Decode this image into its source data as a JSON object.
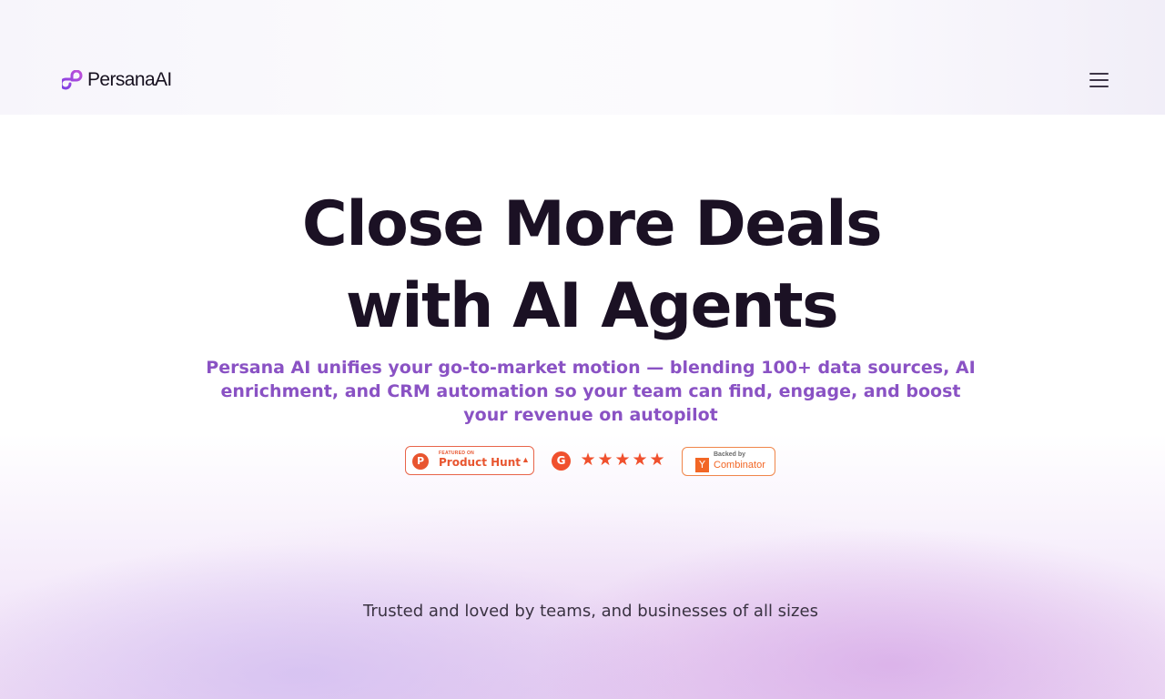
{
  "header": {
    "logo_text": "PersanaAI",
    "logo_icon": "persana-loop-icon",
    "menu_icon": "hamburger-menu-icon"
  },
  "hero": {
    "headline_line1": "Close More Deals",
    "headline_line2": "with AI Agents",
    "subtext": "Persana AI unifies your go-to-market motion — blending 100+ data sources, AI enrichment, and CRM automation so your team can find, engage, and boost your revenue on autopilot"
  },
  "badges": {
    "product_hunt": {
      "letter": "P",
      "kicker": "FEATURED ON",
      "name": "Product Hunt",
      "arrow": "▲"
    },
    "g2": {
      "letter": "G",
      "rating_stars": 5,
      "star_glyph": "★"
    },
    "ycombinator": {
      "letter": "Y",
      "kicker": "Backed by",
      "name": "Combinator"
    }
  },
  "trusted": {
    "text": "Trusted and loved by teams, and businesses of all sizes"
  },
  "colors": {
    "accent_purple": "#8a52c4",
    "headline": "#1b1124",
    "product_hunt": "#e8552f",
    "g2": "#f0502d",
    "ycombinator": "#f26625"
  }
}
